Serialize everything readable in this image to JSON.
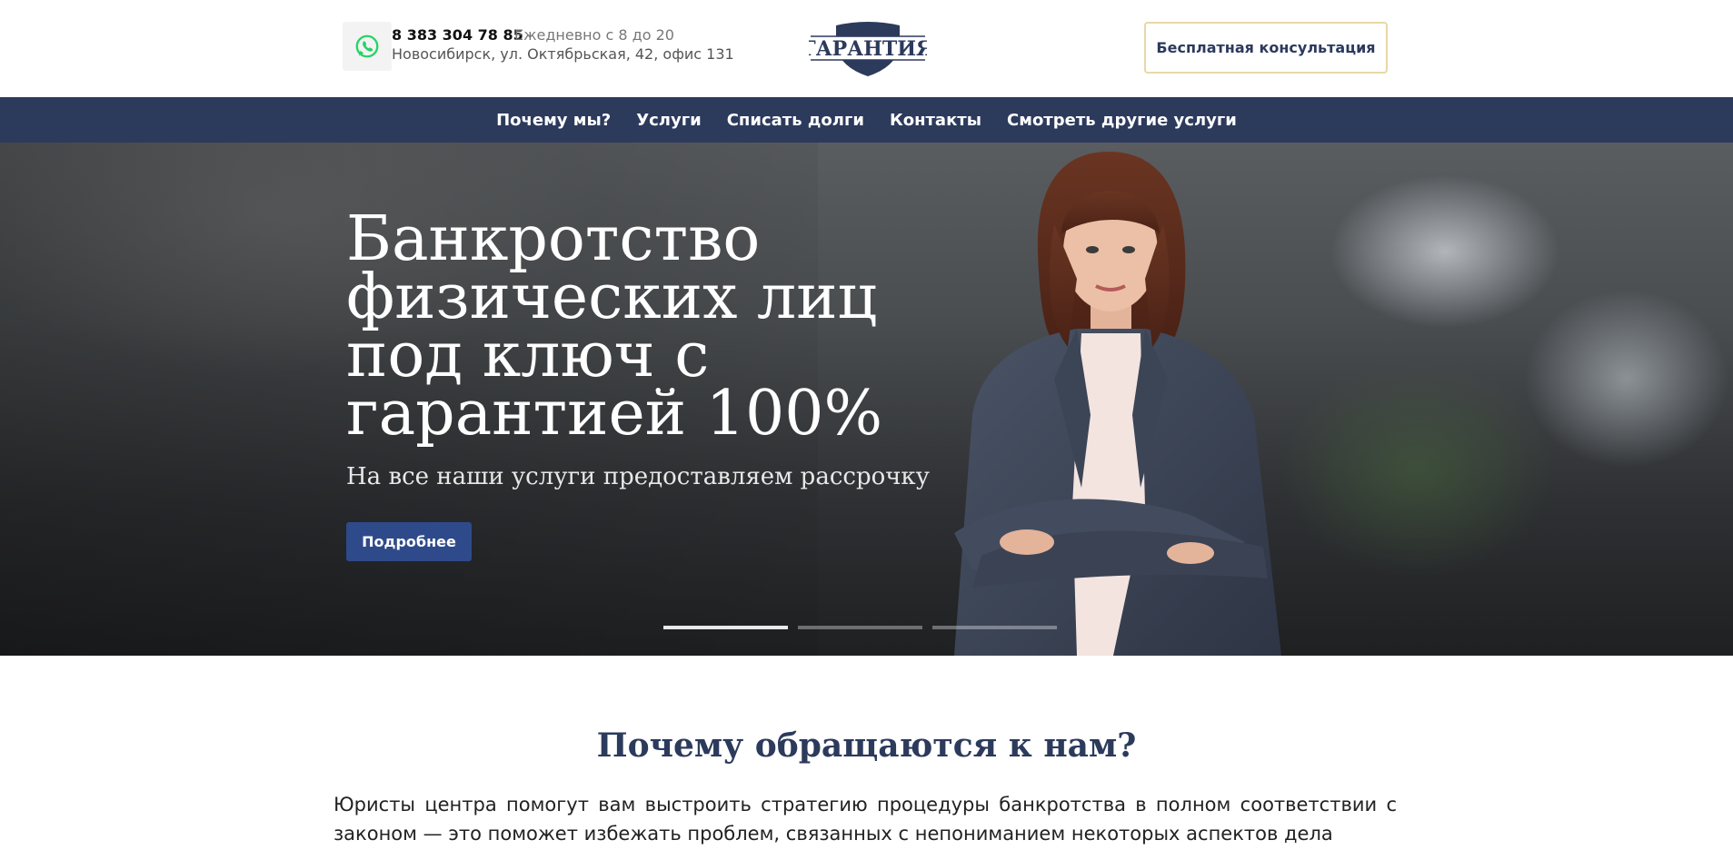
{
  "header": {
    "phone": "8 383 304 78 85",
    "hours": "Ежедневно с 8 до 20",
    "address": "Новосибирск, ул. Октябрьская, 42, офис 131",
    "logo_text": "ГАРАНТИЯ",
    "consult_label": "Бесплатная консультация",
    "whatsapp_icon": "whatsapp-icon"
  },
  "nav": {
    "items": [
      {
        "label": "Почему мы?"
      },
      {
        "label": "Услуги"
      },
      {
        "label": "Списать долги"
      },
      {
        "label": "Контакты"
      },
      {
        "label": "Смотреть другие услуги"
      }
    ]
  },
  "hero": {
    "title": "Банкротство физических лиц под ключ с гарантией 100%",
    "subtitle": "На все наши услуги предоставляем рассрочку",
    "button_label": "Подробнее",
    "slides_total": 3,
    "active_slide": 1
  },
  "why": {
    "title": "Почему обращаются к нам?",
    "text": "Юристы центра помогут вам выстроить стратегию процедуры банкротства в полном соответствии с законом — это поможет избежать проблем, связанных с непониманием некоторых аспектов дела"
  },
  "colors": {
    "brand_navy": "#2c3a5c",
    "button_blue": "#2f4a8a",
    "consult_border": "#e8d8a8",
    "whatsapp_green": "#25d366"
  }
}
